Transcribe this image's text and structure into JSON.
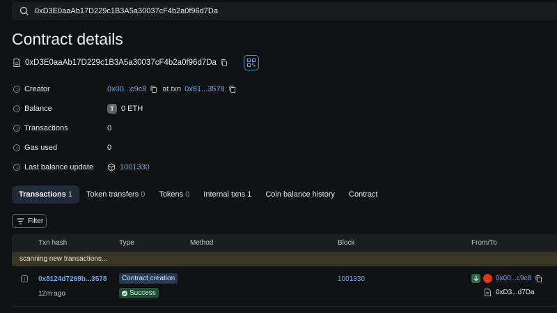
{
  "search": {
    "value": "0xD3E0aaAb17D229c1B3A5a30037cF4b2a0f96d7Da"
  },
  "page": {
    "title": "Contract details"
  },
  "contract": {
    "address": "0xD3E0aaAb17D229c1B3A5a30037cF4b2a0f96d7Da"
  },
  "details": {
    "creator": {
      "label": "Creator",
      "address": "0x00...c9c8",
      "at_txn": "at txn",
      "txn": "0x81...3578"
    },
    "balance": {
      "label": "Balance",
      "token_letter": "T",
      "value": "0 ETH"
    },
    "transactions": {
      "label": "Transactions",
      "value": "0"
    },
    "gas_used": {
      "label": "Gas used",
      "value": "0"
    },
    "last_balance_update": {
      "label": "Last balance update",
      "value": "1001330"
    }
  },
  "tabs": [
    {
      "label": "Transactions",
      "count": "1"
    },
    {
      "label": "Token transfers",
      "count": "0"
    },
    {
      "label": "Tokens",
      "count": "0"
    },
    {
      "label": "Internal txns",
      "count": "1"
    },
    {
      "label": "Coin balance history",
      "count": ""
    },
    {
      "label": "Contract",
      "count": ""
    }
  ],
  "filter": {
    "label": "Filter"
  },
  "table": {
    "headers": {
      "txn_hash": "Txn hash",
      "type": "Type",
      "method": "Method",
      "block": "Block",
      "from_to": "From/To"
    },
    "scanning": "scanning new transactions...",
    "rows": [
      {
        "hash": "0x8124d7269b...3578",
        "age": "12m ago",
        "type": "Contract creation",
        "status": "Success",
        "block": "1001330",
        "from": "0x00...c9c8",
        "to": "0xD3...d7Da"
      }
    ]
  },
  "colors": {
    "link": "#6aa9f0",
    "background": "#101112",
    "success": "#1f4a35",
    "scan_bar": "#3a3624"
  }
}
